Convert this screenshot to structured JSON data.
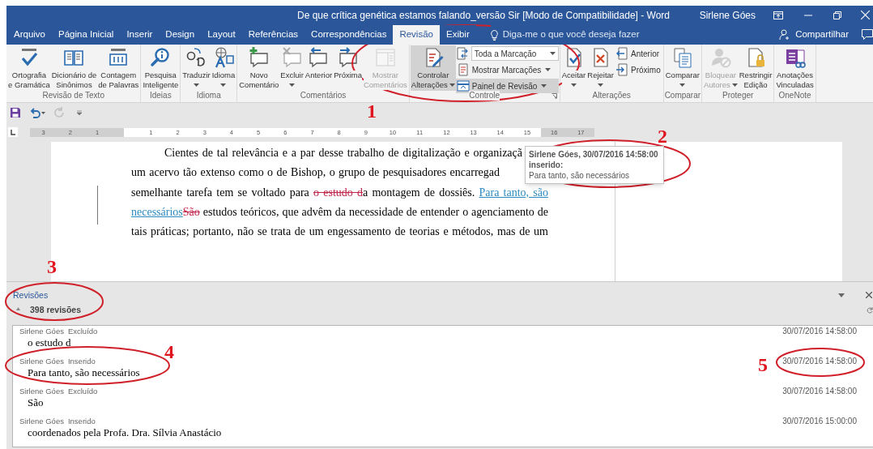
{
  "window": {
    "title": "De que crítica genética estamos falando_versão Sir [Modo de Compatibilidade] - Word",
    "user": "Sirlene Góes"
  },
  "tabs": [
    {
      "label": "Arquivo",
      "selected": false
    },
    {
      "label": "Página Inicial",
      "selected": false
    },
    {
      "label": "Inserir",
      "selected": false
    },
    {
      "label": "Design",
      "selected": false
    },
    {
      "label": "Layout",
      "selected": false
    },
    {
      "label": "Referências",
      "selected": false
    },
    {
      "label": "Correspondências",
      "selected": false
    },
    {
      "label": "Revisão",
      "selected": true
    },
    {
      "label": "Exibir",
      "selected": false
    }
  ],
  "tell_me": {
    "placeholder": "Diga-me o que você deseja fazer"
  },
  "share": {
    "label": "Compartilhar"
  },
  "ribbon": {
    "groups": [
      {
        "label": "Revisão de Texto",
        "launcher": false,
        "items": [
          {
            "kind": "large",
            "lines": [
              "Ortografia",
              "e Gramática"
            ],
            "menu": false,
            "disabled": false,
            "on": false
          },
          {
            "kind": "large",
            "lines": [
              "Dicionário de",
              "Sinônimos"
            ],
            "menu": false,
            "disabled": false,
            "on": false
          },
          {
            "kind": "large",
            "lines": [
              "Contagem",
              "de Palavras"
            ],
            "menu": false,
            "disabled": false,
            "on": false
          }
        ]
      },
      {
        "label": "Ideias",
        "launcher": false,
        "items": [
          {
            "kind": "large",
            "lines": [
              "Pesquisa",
              "Inteligente"
            ],
            "menu": false,
            "disabled": false,
            "on": false
          }
        ]
      },
      {
        "label": "Idioma",
        "launcher": false,
        "items": [
          {
            "kind": "large",
            "lines": [
              "Traduzir"
            ],
            "menu": true,
            "disabled": false,
            "on": false
          },
          {
            "kind": "large",
            "lines": [
              "Idioma"
            ],
            "menu": true,
            "disabled": false,
            "on": false
          }
        ]
      },
      {
        "label": "Comentários",
        "launcher": false,
        "items": [
          {
            "kind": "large",
            "lines": [
              "Novo",
              "Comentário"
            ],
            "menu": false,
            "disabled": false,
            "on": false
          },
          {
            "kind": "large",
            "lines": [
              "Excluir"
            ],
            "menu": true,
            "disabled": false,
            "on": false
          },
          {
            "kind": "large",
            "lines": [
              "Anterior"
            ],
            "menu": false,
            "disabled": false,
            "on": false
          },
          {
            "kind": "large",
            "lines": [
              "Próxima"
            ],
            "menu": false,
            "disabled": false,
            "on": false
          },
          {
            "kind": "large",
            "lines": [
              "Mostrar",
              "Comentários"
            ],
            "menu": false,
            "disabled": true,
            "on": false
          }
        ]
      },
      {
        "label": "Controle",
        "launcher": true,
        "items": [
          {
            "kind": "large",
            "lines": [
              "Controlar",
              "Alterações"
            ],
            "menu": true,
            "disabled": false,
            "on": true
          },
          {
            "kind": "stack",
            "items": [
              {
                "kind": "dropdown",
                "value": "Toda a Marcação"
              },
              {
                "kind": "small",
                "label": "Mostrar Marcações",
                "menu": true,
                "on": false
              },
              {
                "kind": "small",
                "label": "Painel de Revisão",
                "menu": true,
                "on": true
              }
            ]
          }
        ]
      },
      {
        "label": "Alterações",
        "launcher": false,
        "items": [
          {
            "kind": "large",
            "lines": [
              "Aceitar"
            ],
            "menu": true,
            "disabled": false,
            "on": false
          },
          {
            "kind": "large",
            "lines": [
              "Rejeitar"
            ],
            "menu": true,
            "disabled": false,
            "on": false
          },
          {
            "kind": "stack",
            "items": [
              {
                "kind": "small",
                "label": "Anterior",
                "menu": false,
                "on": false
              },
              {
                "kind": "small",
                "label": "Próximo",
                "menu": false,
                "on": false
              }
            ]
          }
        ]
      },
      {
        "label": "Comparar",
        "launcher": false,
        "items": [
          {
            "kind": "large",
            "lines": [
              "Comparar"
            ],
            "menu": true,
            "disabled": false,
            "on": false
          }
        ]
      },
      {
        "label": "Proteger",
        "launcher": false,
        "items": [
          {
            "kind": "large",
            "lines": [
              "Bloquear",
              "Autores"
            ],
            "menu": true,
            "disabled": true,
            "on": false
          },
          {
            "kind": "large",
            "lines": [
              "Restringir",
              "Edição"
            ],
            "menu": false,
            "disabled": false,
            "on": false
          }
        ]
      },
      {
        "label": "OneNote",
        "launcher": false,
        "items": [
          {
            "kind": "large",
            "lines": [
              "Anotações",
              "Vinculadas"
            ],
            "menu": false,
            "disabled": false,
            "on": false
          }
        ]
      }
    ]
  },
  "quick_access": [
    {
      "disabled": false
    },
    {
      "disabled": false
    },
    {
      "disabled": true
    },
    {
      "disabled": false
    }
  ],
  "ruler": {
    "left_labels": [
      "3",
      "2",
      "1"
    ],
    "labels": [
      "1",
      "2",
      "3",
      "4",
      "5",
      "6",
      "7",
      "8",
      "9",
      "10",
      "11",
      "12",
      "13",
      "14",
      "15",
      "16",
      "17"
    ]
  },
  "document": {
    "change_bar": true,
    "lines": [
      {
        "indent": true,
        "segments": [
          {
            "kind": "normal",
            "text": "Cientes de tal relevância e a par desse trabalho de digitalização e organizaçã"
          }
        ]
      },
      {
        "indent": false,
        "segments": [
          {
            "kind": "normal",
            "text": "um acervo tão extenso como o de Bishop, o grupo de pesquisadores encarregad"
          }
        ]
      },
      {
        "indent": false,
        "segments": [
          {
            "kind": "normal",
            "text": "semelhante tarefa tem se voltado para "
          },
          {
            "kind": "deleted",
            "text": "o estudo d"
          },
          {
            "kind": "normal",
            "text": "a montagem de dossiês. "
          },
          {
            "kind": "inserted",
            "text": "Para tanto, são"
          }
        ]
      },
      {
        "indent": false,
        "segments": [
          {
            "kind": "inserted",
            "text": "necessários"
          },
          {
            "kind": "deleted",
            "text": "São"
          },
          {
            "kind": "normal",
            "text": " estudos teóricos, que advêm da necessidade de entender o agenciamento de"
          }
        ]
      },
      {
        "indent": false,
        "segments": [
          {
            "kind": "normal",
            "text": "tais práticas; portanto, não se trata de um engessamento de teorias e métodos, mas de um"
          }
        ]
      }
    ]
  },
  "tooltip": {
    "heading": "Sirlene Góes, 30/07/2016 14:58:00",
    "action": "inserido:",
    "text": "Para tanto, são necessários"
  },
  "revisions_pane": {
    "title": "Revisões",
    "summary": "398 revisões",
    "items": [
      {
        "author": "Sirlene Góes",
        "action": "Excluído",
        "text": "o estudo d",
        "date": "30/07/2016 14:58:00"
      },
      {
        "author": "Sirlene Góes",
        "action": "Inserido",
        "text": "Para tanto, são necessários",
        "date": "30/07/2016 14:58:00"
      },
      {
        "author": "Sirlene Góes",
        "action": "Excluído",
        "text": "São",
        "date": "30/07/2016 14:58:00"
      },
      {
        "author": "Sirlene Góes",
        "action": "Inserido",
        "text": "coordenados pela Profa. Dra. Sílvia Anastácio",
        "date": "30/07/2016 15:00:00"
      }
    ]
  },
  "annotations": [
    {
      "label": "1"
    },
    {
      "label": "2"
    },
    {
      "label": "3"
    },
    {
      "label": "4"
    },
    {
      "label": "5"
    }
  ]
}
